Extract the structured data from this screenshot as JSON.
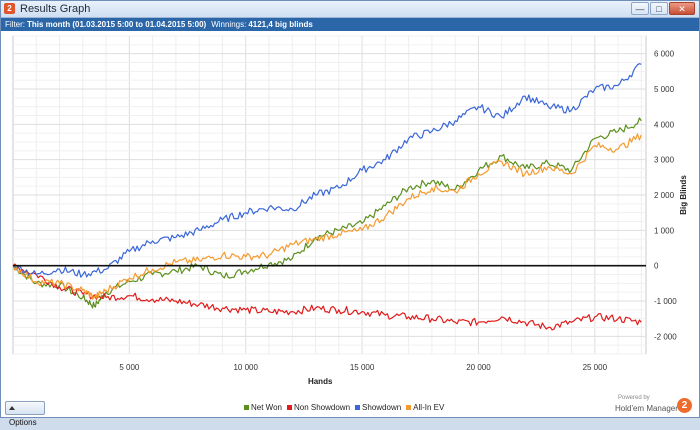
{
  "window": {
    "title": "Results Graph",
    "app_icon": "hem-logo-icon"
  },
  "title_buttons": {
    "minimize": "—",
    "maximize": "□",
    "close": "✕"
  },
  "filter": {
    "label": "Filter:",
    "value": "This month (01.03.2015 5:00 to 01.04.2015 5:00)",
    "winnings_label": "Winnings:",
    "winnings_value": "4121,4 big blinds"
  },
  "chart_data": {
    "type": "line",
    "xlabel": "Hands",
    "ylabel": "Big Blinds",
    "xlim": [
      0,
      27200
    ],
    "ylim": [
      -2500,
      6500
    ],
    "x_ticks": [
      5000,
      10000,
      15000,
      20000,
      25000
    ],
    "x_tick_labels": [
      "5 000",
      "10 000",
      "15 000",
      "20 000",
      "25 000"
    ],
    "y_ticks": [
      6000,
      5000,
      4000,
      3000,
      2000,
      1000,
      0,
      -1000,
      -2000
    ],
    "y_tick_labels": [
      "6 000",
      "5 000",
      "4 000",
      "3 000",
      "2 000",
      "1 000",
      "0",
      "-1 000",
      "-2 000"
    ],
    "grid": true,
    "legend_position": "bottom-center",
    "series": [
      {
        "name": "Net Won",
        "color": "#5b8f1e",
        "x": [
          0,
          1000,
          2000,
          3000,
          3500,
          4000,
          5000,
          6000,
          7000,
          8000,
          9000,
          10000,
          11000,
          12000,
          13000,
          14000,
          15000,
          16000,
          17000,
          18000,
          19000,
          20000,
          21000,
          22000,
          23000,
          24000,
          25000,
          26000,
          27000
        ],
        "y": [
          0,
          -500,
          -550,
          -900,
          -1150,
          -750,
          -450,
          -250,
          -150,
          0,
          -300,
          -150,
          50,
          200,
          800,
          1000,
          1200,
          1700,
          2200,
          2400,
          2150,
          2700,
          3100,
          2750,
          2900,
          2700,
          3600,
          3800,
          4100
        ]
      },
      {
        "name": "Non Showdown",
        "color": "#e11b1b",
        "x": [
          0,
          1000,
          2000,
          3000,
          4000,
          5000,
          6000,
          7000,
          8000,
          9000,
          10000,
          11000,
          12000,
          13000,
          14000,
          15000,
          16000,
          17000,
          18000,
          19000,
          20000,
          21000,
          22000,
          23000,
          24000,
          25000,
          26000,
          27000
        ],
        "y": [
          0,
          -250,
          -600,
          -800,
          -900,
          -850,
          -950,
          -1000,
          -1100,
          -1200,
          -1250,
          -1300,
          -1300,
          -1200,
          -1250,
          -1300,
          -1400,
          -1450,
          -1500,
          -1600,
          -1600,
          -1450,
          -1600,
          -1750,
          -1600,
          -1450,
          -1500,
          -1600
        ]
      },
      {
        "name": "Showdown",
        "color": "#3a67d8",
        "x": [
          0,
          1000,
          2000,
          3000,
          4000,
          5000,
          6000,
          7000,
          8000,
          9000,
          10000,
          11000,
          12000,
          13000,
          14000,
          15000,
          16000,
          17000,
          18000,
          19000,
          20000,
          21000,
          22000,
          23000,
          24000,
          25000,
          26000,
          27000
        ],
        "y": [
          0,
          -250,
          -100,
          -250,
          -100,
          400,
          700,
          800,
          1000,
          1300,
          1500,
          1650,
          1600,
          2000,
          2200,
          2700,
          3000,
          3600,
          3800,
          4100,
          4500,
          4200,
          4800,
          4500,
          4400,
          5000,
          5100,
          5700
        ]
      },
      {
        "name": "All-In EV",
        "color": "#f59a2e",
        "x": [
          0,
          1000,
          2000,
          3000,
          3500,
          4000,
          5000,
          6000,
          7000,
          8000,
          9000,
          10000,
          11000,
          12000,
          13000,
          14000,
          15000,
          16000,
          17000,
          18000,
          19000,
          20000,
          21000,
          22000,
          23000,
          24000,
          25000,
          26000,
          27000
        ],
        "y": [
          0,
          -450,
          -500,
          -700,
          -900,
          -700,
          -350,
          -100,
          100,
          150,
          300,
          250,
          300,
          600,
          750,
          900,
          1000,
          1400,
          1900,
          2200,
          2100,
          2600,
          2950,
          2600,
          2800,
          2600,
          3400,
          3300,
          3700
        ]
      }
    ]
  },
  "footer": {
    "options_label": "Options",
    "powered_by": "Powered by",
    "brand_name": "Hold'em Manager",
    "brand_logo_text": "2"
  }
}
